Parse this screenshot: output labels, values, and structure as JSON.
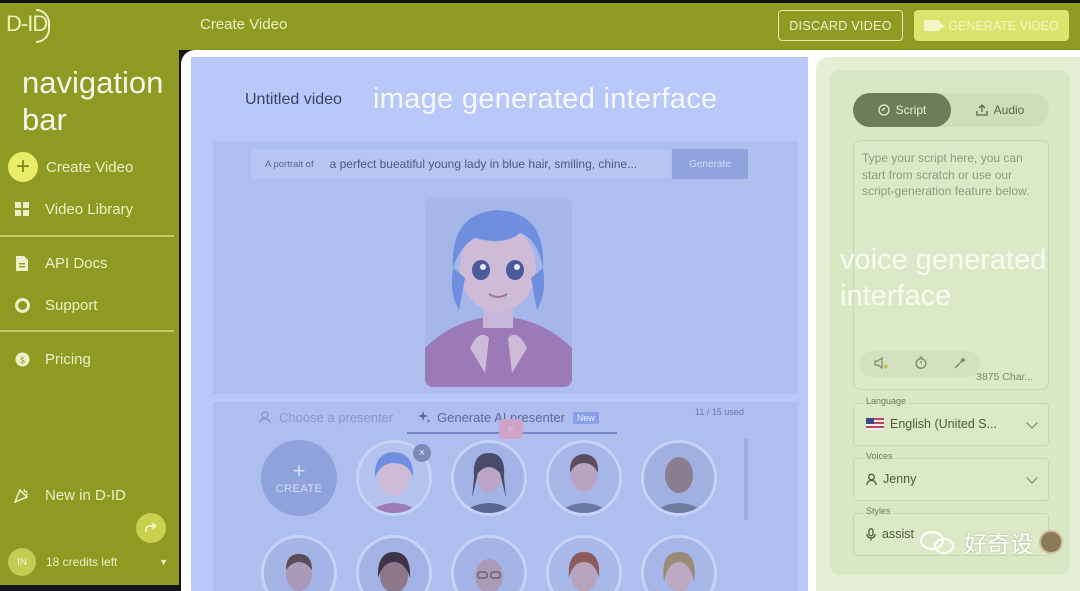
{
  "header": {
    "logo_text": "D-ID",
    "page_title": "Create Video",
    "discard_label": "DISCARD VIDEO",
    "generate_label": "GENERATE VIDEO"
  },
  "annotations": {
    "navigation_bar": "navigation bar",
    "image_interface": "image generated interface",
    "voice_interface": "voice generated interface"
  },
  "sidebar": {
    "items": [
      {
        "label": "Create Video",
        "icon": "plus-icon"
      },
      {
        "label": "Video Library",
        "icon": "grid-icon"
      },
      {
        "label": "API Docs",
        "icon": "document-icon"
      },
      {
        "label": "Support",
        "icon": "lifebuoy-icon"
      },
      {
        "label": "Pricing",
        "icon": "dollar-icon"
      },
      {
        "label": "New in D-ID",
        "icon": "party-icon"
      }
    ],
    "user_initials": "IN",
    "credits_text": "18 credits left"
  },
  "image_panel": {
    "video_title": "Untitled video",
    "prompt_prefix": "A portrait of",
    "prompt_text": "a perfect bueatiful young lady in blue hair, smiling, chine...",
    "generate_label": "Generate",
    "tabs": {
      "choose": "Choose a presenter",
      "generate": "Generate AI presenter",
      "new_badge": "New"
    },
    "usage": "11 / 15 used",
    "create_label": "CREATE"
  },
  "voice_panel": {
    "tab_script": "Script",
    "tab_audio": "Audio",
    "script_placeholder": "Type your script here, you can start from scratch or use our script-generation feature below.",
    "char_count": "3875 Char...",
    "language_label": "Language",
    "language_value": "English (United S...",
    "voices_label": "Voices",
    "voice_value": "Jenny",
    "styles_label": "Styles",
    "style_value": "assist"
  },
  "watermark": {
    "text": "好奇设"
  },
  "colors": {
    "brand_olive": "#8e9a22",
    "accent_yellow": "#dbe46d",
    "overlay_blue": "#b8c8f8",
    "overlay_green": "#d9e8c4"
  }
}
